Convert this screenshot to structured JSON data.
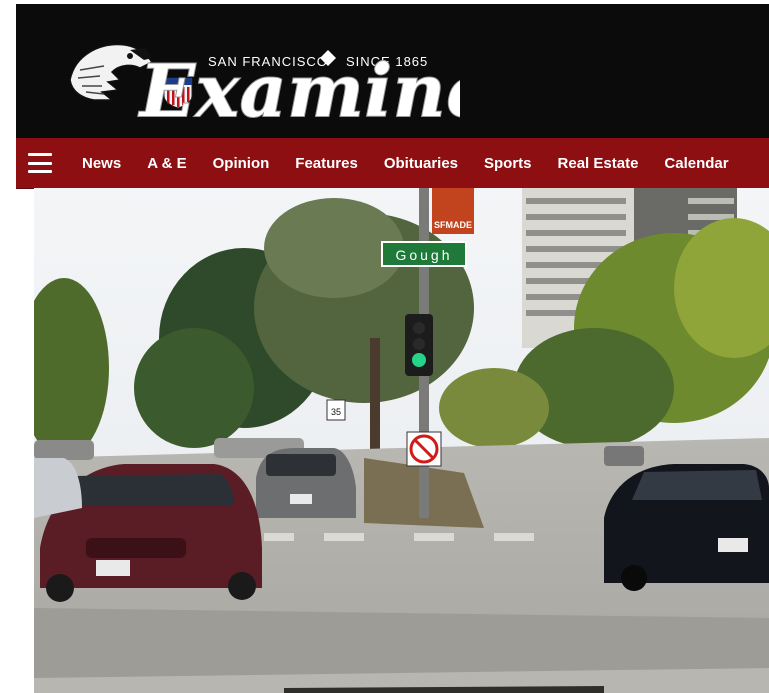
{
  "masthead": {
    "city": "SAN FRANCISCO",
    "since": "SINCE 1865",
    "name": "Examiner",
    "background": "#0b0b0b"
  },
  "nav": {
    "background": "#8e0f12",
    "menu_icon": "hamburger-menu-icon",
    "items": [
      {
        "label": "News"
      },
      {
        "label": "A & E"
      },
      {
        "label": "Opinion"
      },
      {
        "label": "Features"
      },
      {
        "label": "Obituaries"
      },
      {
        "label": "Sports"
      },
      {
        "label": "Real Estate"
      },
      {
        "label": "Calendar"
      }
    ]
  },
  "hero": {
    "street_sign": "Gough",
    "banner_text": "SFMADE",
    "speed_sign": "35"
  }
}
